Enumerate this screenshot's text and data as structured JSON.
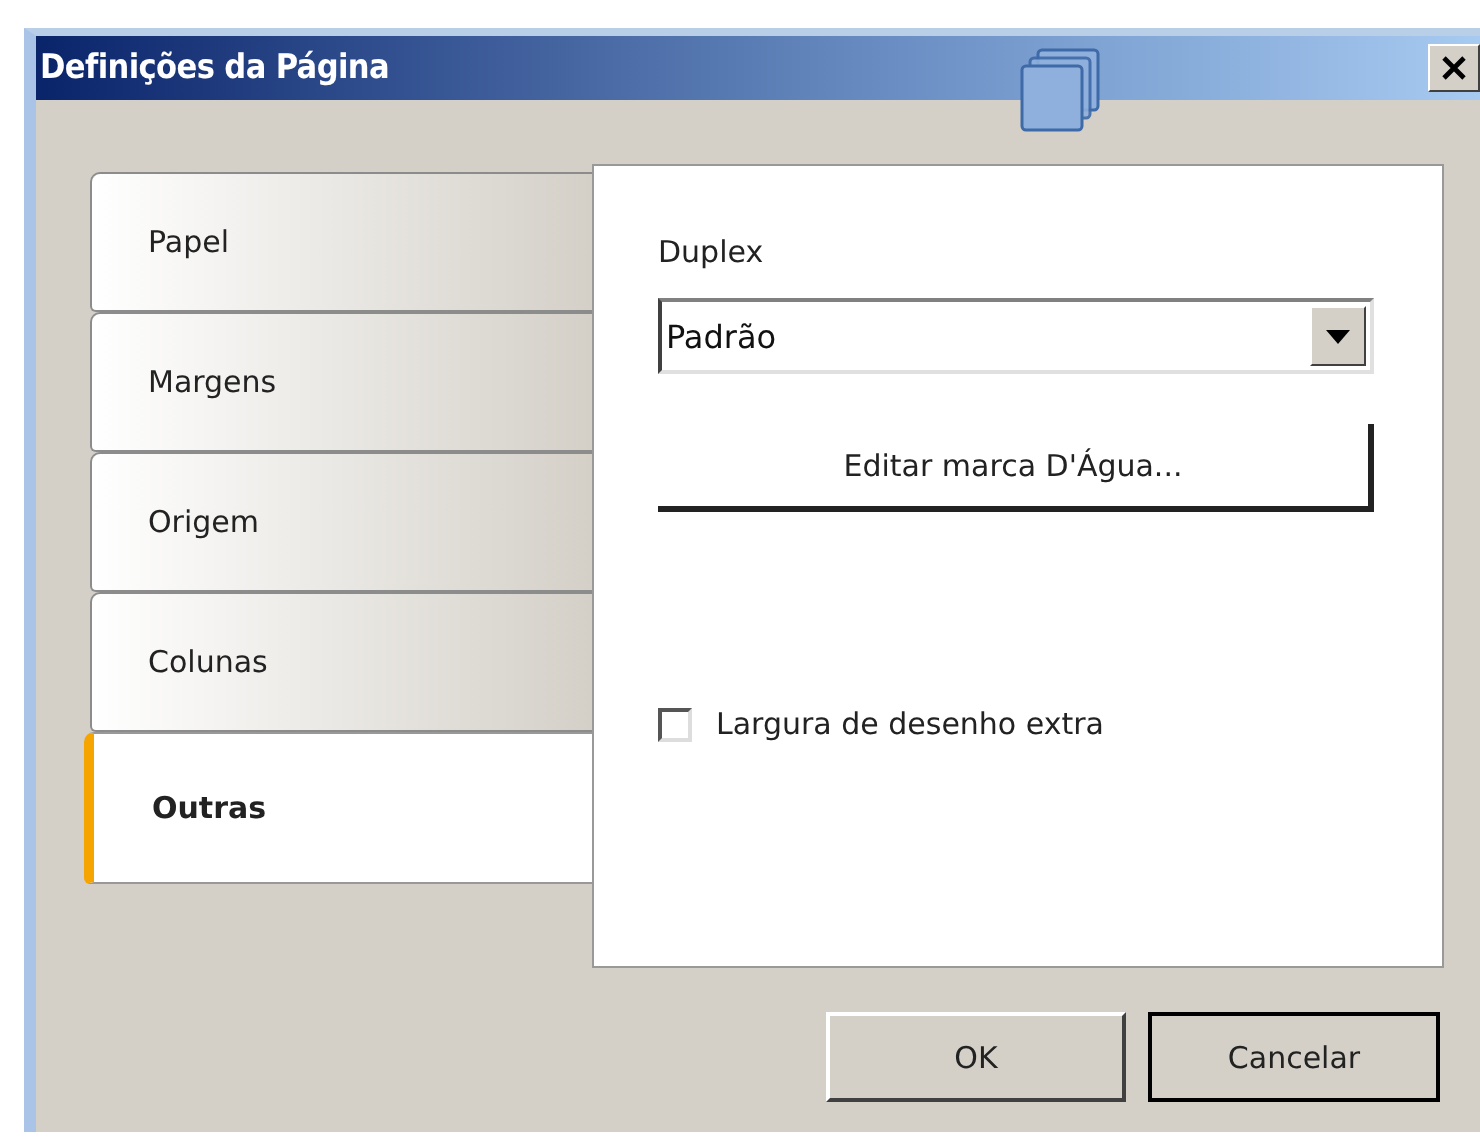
{
  "window": {
    "title": "Definições da Página"
  },
  "tabs": [
    {
      "label": "Papel",
      "selected": false
    },
    {
      "label": "Margens",
      "selected": false
    },
    {
      "label": "Origem",
      "selected": false
    },
    {
      "label": "Colunas",
      "selected": false
    },
    {
      "label": "Outras",
      "selected": true
    }
  ],
  "duplex": {
    "label": "Duplex",
    "value": "Padrão"
  },
  "watermark_button": {
    "label": "Editar marca D'Água..."
  },
  "extra_width": {
    "label": "Largura de desenho extra",
    "checked": false
  },
  "buttons": [
    {
      "label": "OK",
      "default": false
    },
    {
      "label": "Cancelar",
      "default": true
    }
  ]
}
